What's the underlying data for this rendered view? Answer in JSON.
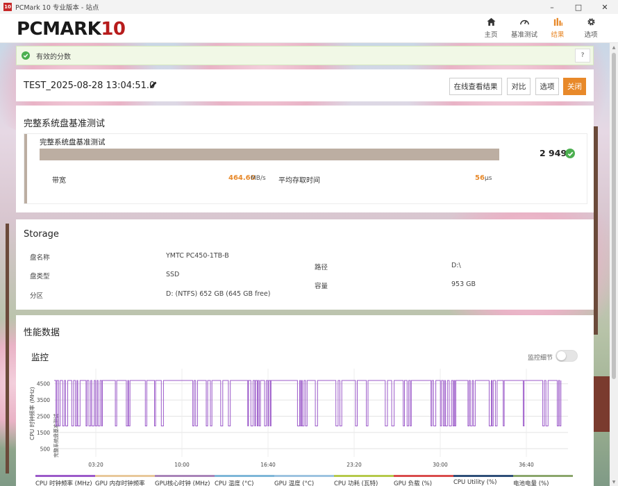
{
  "window": {
    "icon_text": "10",
    "title": "PCMark 10 专业版本 - 站点"
  },
  "header": {
    "logo_main": "PCMARK",
    "logo_num": "10",
    "nav": [
      {
        "label": "主页",
        "icon": "home-icon"
      },
      {
        "label": "基准测试",
        "icon": "gauge-icon"
      },
      {
        "label": "结果",
        "icon": "bar-chart-icon",
        "active": true
      },
      {
        "label": "选项",
        "icon": "gear-icon"
      }
    ]
  },
  "valid_banner": {
    "text": "有效的分数",
    "help": "?"
  },
  "test": {
    "name": "TEST_2025-08-28 13:04:51.0",
    "buttons": {
      "online": "在线查看结果",
      "compare": "对比",
      "options": "选项",
      "close": "关闭"
    }
  },
  "benchmark": {
    "heading": "完整系统盘基准测试",
    "card_title": "完整系统盘基准测试",
    "score": "2 949",
    "bandwidth_label": "带宽",
    "bandwidth_value": "464.60",
    "bandwidth_unit": "MB/s",
    "latency_label": "平均存取时间",
    "latency_value": "56",
    "latency_unit": "μs"
  },
  "storage": {
    "heading": "Storage",
    "rows": [
      {
        "label": "盘名称",
        "value": "YMTC PC450-1TB-B"
      },
      {
        "label": "盘类型",
        "value": "SSD"
      },
      {
        "label": "分区",
        "value": "D: (NTFS) 652 GB (645 GB free)"
      }
    ],
    "right_rows": [
      {
        "label": "路径",
        "value": "D:\\"
      },
      {
        "label": "容量",
        "value": "953 GB"
      }
    ]
  },
  "performance": {
    "heading": "性能数据",
    "monitor_title": "监控",
    "monitor_detail": "监控细节",
    "ylabel": "CPU 时钟频率 (MHz)",
    "ylabel_right": "完整系统盘基准测试"
  },
  "chart_data": {
    "type": "line",
    "series": [
      {
        "name": "CPU 时钟频率 (MHz)",
        "color": "#9b59c9"
      }
    ],
    "yticks": [
      500,
      1500,
      2500,
      3500,
      4500
    ],
    "xticks": [
      "03:20",
      "10:00",
      "16:40",
      "23:20",
      "30:00",
      "36:40"
    ],
    "ylim": [
      0,
      5000
    ],
    "xlim": [
      0,
      2320
    ],
    "high": 4700,
    "low": 1900,
    "legend": [
      {
        "label": "CPU 时钟频率 (MHz)",
        "color": "#9b59c9"
      },
      {
        "label": "GPU 内存时钟频率",
        "color": "#e8c89a"
      },
      {
        "label": "GPU核心时钟 (MHz)",
        "color": "#a883b8"
      },
      {
        "label": "CPU 温度 (°C)",
        "color": "#7db6d8"
      },
      {
        "label": "GPU 温度 (°C)",
        "color": "#9cc3e0"
      },
      {
        "label": "CPU 功耗 (瓦特)",
        "color": "#b5c94a"
      },
      {
        "label": "GPU 负载 (%)",
        "color": "#d94b4b"
      },
      {
        "label": "CPU Utility (%)",
        "color": "#2e4e78"
      },
      {
        "label": "电池电量 (%)",
        "color": "#8aa66b"
      }
    ],
    "grid": true
  }
}
